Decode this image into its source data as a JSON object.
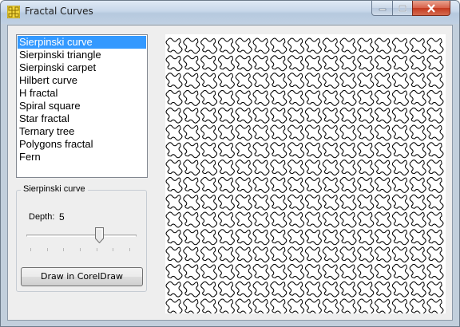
{
  "window": {
    "title": "Fractal Curves",
    "controls": {
      "minimize": "minimize-icon",
      "maximize": "maximize-icon",
      "close": "close-icon"
    }
  },
  "fractal_list": {
    "selected_index": 0,
    "items": [
      "Sierpinski curve",
      "Sierpinski triangle",
      "Sierpinski carpet",
      "Hilbert curve",
      "H fractal",
      "Spiral square",
      "Star fractal",
      "Ternary tree",
      "Polygons fractal",
      "Fern"
    ]
  },
  "settings": {
    "group_title": "Sierpinski curve",
    "depth_label": "Depth:",
    "depth_value": "5",
    "slider": {
      "min": 1,
      "max": 7,
      "value": 5
    },
    "draw_button": "Draw in CorelDraw"
  },
  "colors": {
    "selection": "#3399ff",
    "curve": "#000000"
  }
}
